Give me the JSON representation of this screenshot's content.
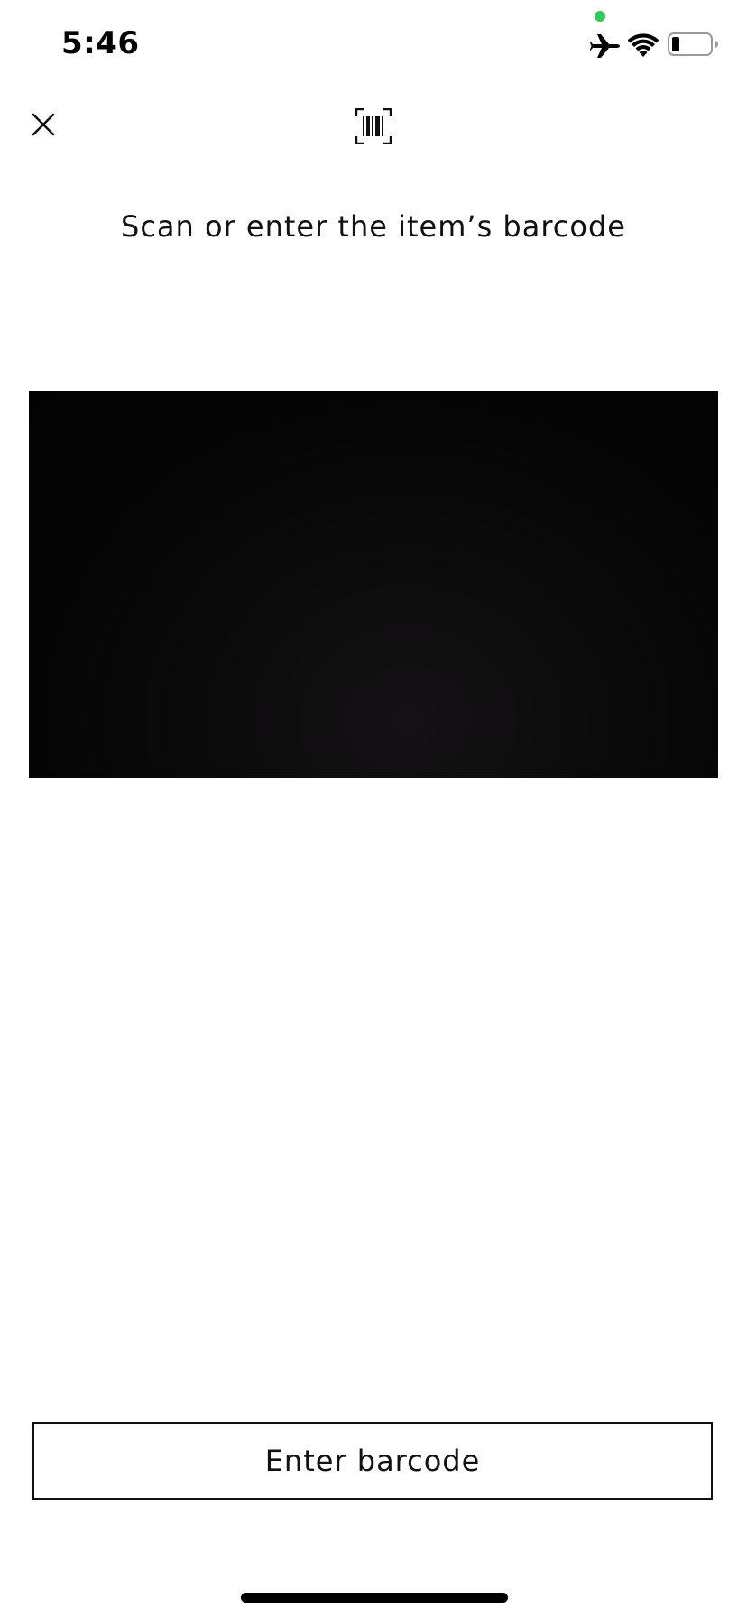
{
  "status_bar": {
    "time": "5:46"
  },
  "header": {
    "close_icon": "close-icon",
    "barcode_icon": "barcode-scan-icon"
  },
  "main": {
    "title": "Scan or enter the item’s barcode"
  },
  "footer": {
    "enter_button_label": "Enter barcode"
  },
  "colors": {
    "mic_indicator": "#34c759",
    "camera_background": "#050505",
    "text": "#111111",
    "background": "#ffffff"
  }
}
